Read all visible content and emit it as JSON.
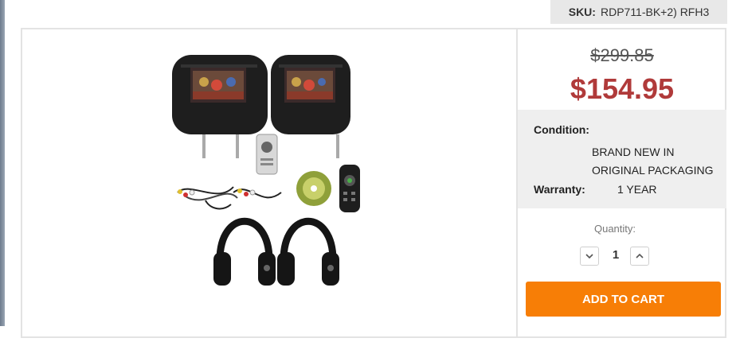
{
  "sku": {
    "label": "SKU:",
    "value": "RDP711-BK+2) RFH3"
  },
  "product": {
    "image_alt": "Two headrest DVD monitors with remotes, cables, disc and wireless headphones"
  },
  "pricing": {
    "old_price": "$299.85",
    "new_price": "$154.95"
  },
  "details": {
    "condition_label": "Condition:",
    "condition_line1": "BRAND NEW IN",
    "condition_line2": "ORIGINAL PACKAGING",
    "warranty_label": "Warranty:",
    "warranty_value": "1 YEAR"
  },
  "quantity": {
    "label": "Quantity:",
    "value": "1"
  },
  "cart": {
    "button_label": "ADD TO CART"
  },
  "colors": {
    "price_red": "#b03a3a",
    "cart_orange": "#f77e06",
    "panel_gray": "#efefef"
  }
}
